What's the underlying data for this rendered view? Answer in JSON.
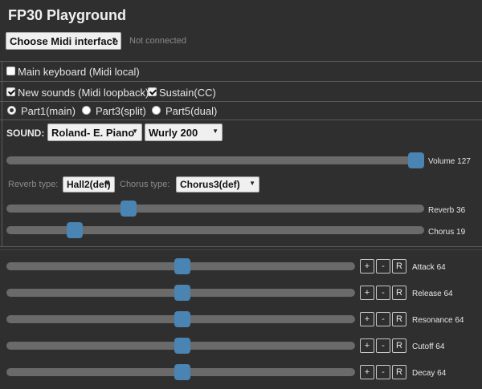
{
  "title": "FP30 Playground",
  "midi": {
    "select_label": "Choose Midi interface",
    "status": "Not connected"
  },
  "options": {
    "main_keyboard": {
      "label": "Main keyboard (Midi local)",
      "checked": false
    },
    "new_sounds": {
      "label": "New sounds (Midi loopback)",
      "checked": true
    },
    "sustain": {
      "label": "Sustain(CC)",
      "checked": true
    }
  },
  "parts": [
    {
      "label": "Part1(main)",
      "selected": true
    },
    {
      "label": "Part3(split)",
      "selected": false
    },
    {
      "label": "Part5(dual)",
      "selected": false
    }
  ],
  "sound": {
    "label": "SOUND:",
    "category": "Roland- E. Piano",
    "patch": "Wurly 200"
  },
  "volume": {
    "label": "Volume",
    "value": 127,
    "max": 127
  },
  "effects": {
    "reverb_type_label": "Reverb type:",
    "reverb_type": "Hall2(def)",
    "chorus_type_label": "Chorus type:",
    "chorus_type": "Chorus3(def)",
    "reverb": {
      "label": "Reverb",
      "value": 36,
      "max": 127
    },
    "chorus": {
      "label": "Chorus",
      "value": 19,
      "max": 127
    }
  },
  "envelope": {
    "buttons": {
      "plus": "+",
      "minus": "-",
      "reset": "R"
    },
    "controls": [
      {
        "label": "Attack",
        "value": 64,
        "max": 127
      },
      {
        "label": "Release",
        "value": 64,
        "max": 127
      },
      {
        "label": "Resonance",
        "value": 64,
        "max": 127
      },
      {
        "label": "Cutoff",
        "value": 64,
        "max": 127
      },
      {
        "label": "Decay",
        "value": 64,
        "max": 127
      }
    ]
  }
}
